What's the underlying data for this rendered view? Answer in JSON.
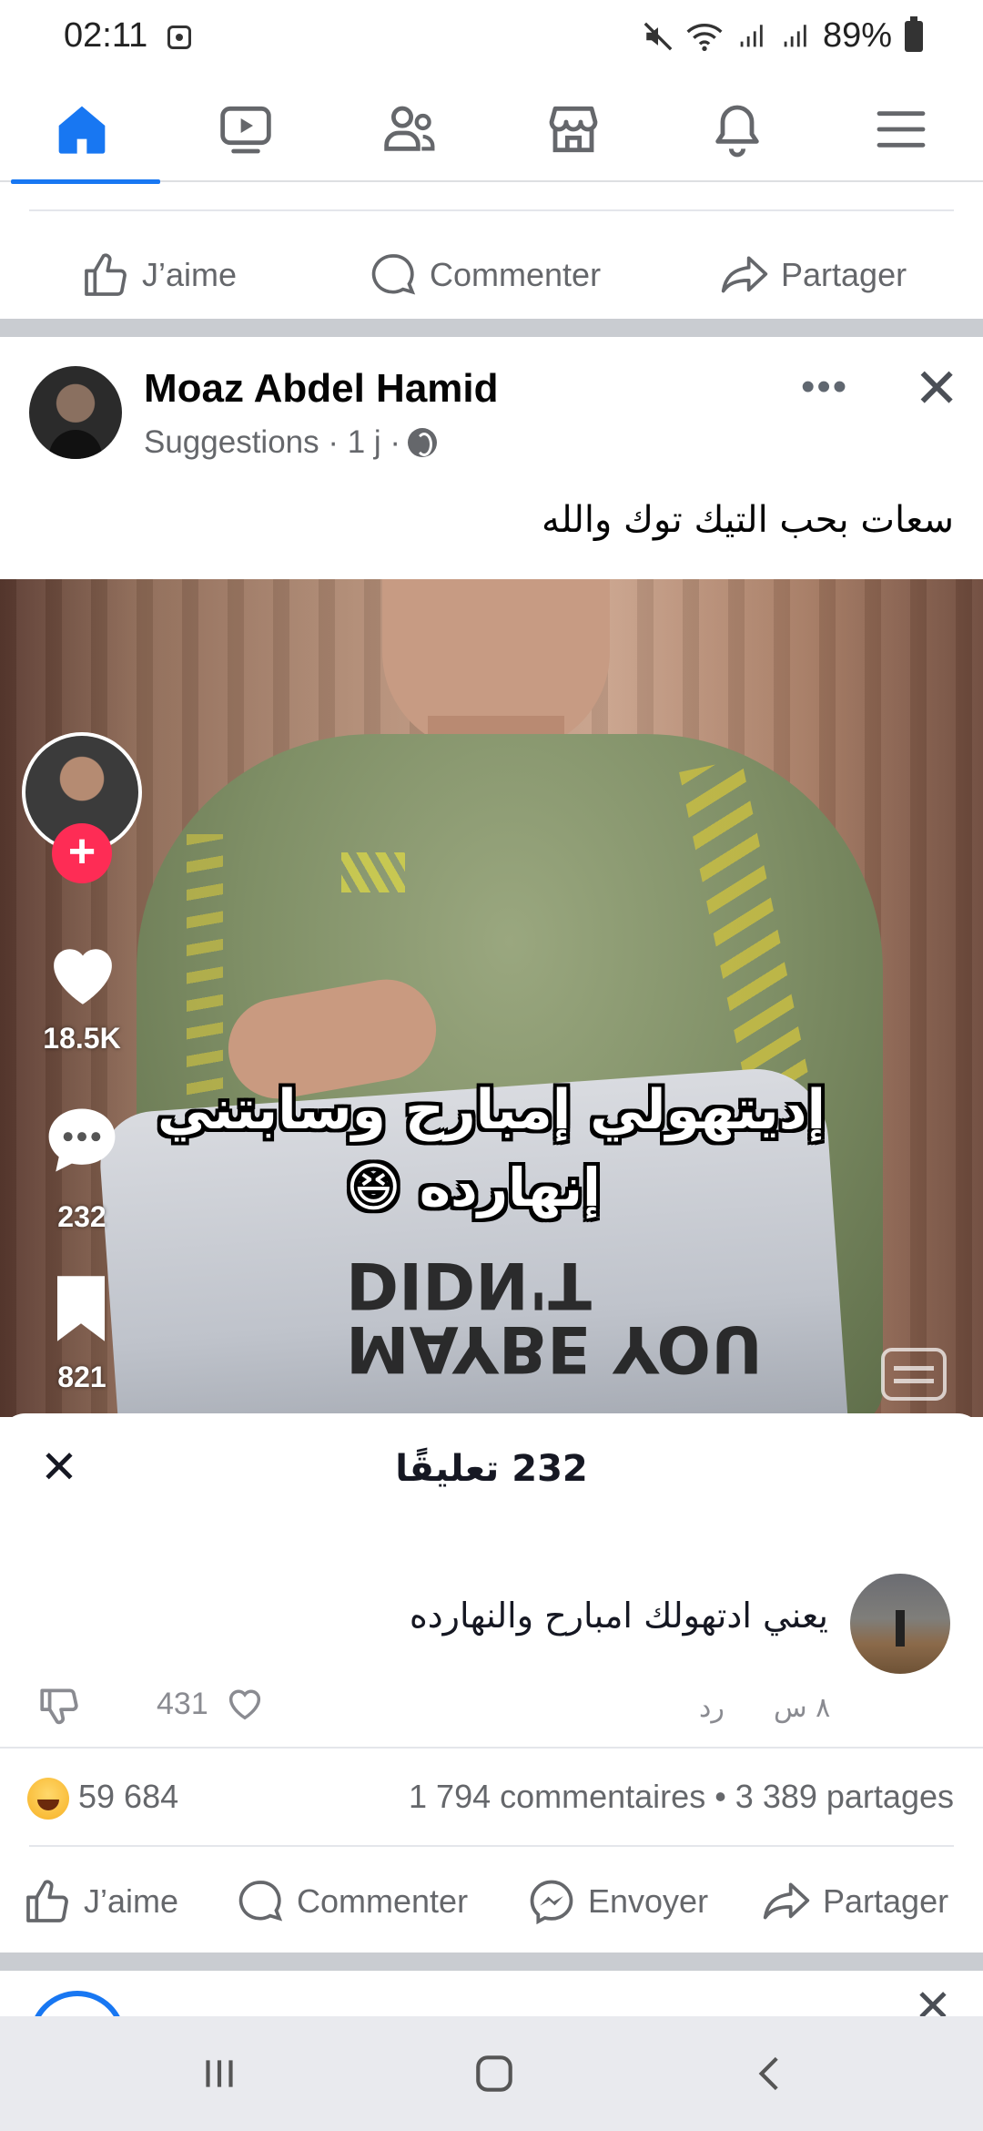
{
  "status_bar": {
    "time": "02:11",
    "battery": "89%",
    "icons": [
      "mute-icon",
      "wifi-icon",
      "signal-icon",
      "signal-icon",
      "battery-icon"
    ]
  },
  "nav": {
    "items": [
      "home-icon",
      "video-icon",
      "friends-icon",
      "marketplace-icon",
      "bell-icon",
      "menu-icon"
    ],
    "active": "home-icon",
    "accent": "#1877f2"
  },
  "top_actions": {
    "like": "J’aime",
    "comment": "Commenter",
    "share": "Partager"
  },
  "post": {
    "author": "Moaz Abdel Hamid",
    "meta": "Suggestions · 1 j ·",
    "more": "•••",
    "close": "✕",
    "text": "سعات بحب التيك توك والله"
  },
  "video": {
    "caption_line1": "إديتهولي إمبارح وسابتني",
    "caption_line2": "إنهارده 😆",
    "shirt_text": "MAYBE YOU\nDIDN'T",
    "likes": "18.5K",
    "comments": "232",
    "saves": "821",
    "follow_plus": "+"
  },
  "comments_sheet": {
    "title": "232 تعليقًا",
    "close": "✕",
    "comment_text": "يعني ادتهولك امبارح والنهارده",
    "comment_time": "٨ س",
    "comment_reply": "رد",
    "comment_likes": "431"
  },
  "post_stats": {
    "reactions_count": "59 684",
    "comments_shares": "1 794 commentaires • 3 389 partages"
  },
  "bottom_actions": {
    "like": "J’aime",
    "comment": "Commenter",
    "send": "Envoyer",
    "share": "Partager"
  }
}
